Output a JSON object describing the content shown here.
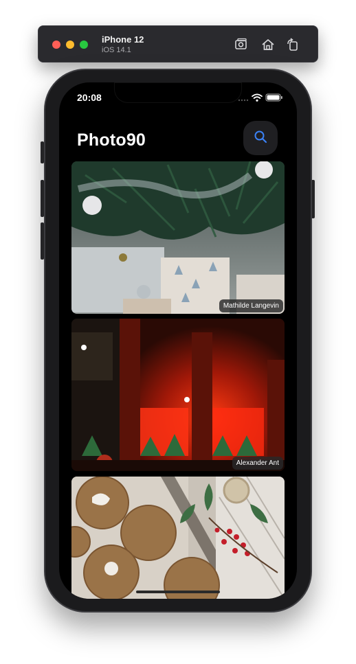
{
  "simulator": {
    "device_name": "iPhone 12",
    "os_version": "iOS 14.1"
  },
  "status_bar": {
    "time": "20:08"
  },
  "app": {
    "title": "Photo90"
  },
  "photos": [
    {
      "credit": "Mathilde Langevin"
    },
    {
      "credit": "Alexander Ant"
    },
    {
      "credit": ""
    }
  ],
  "colors": {
    "accent": "#3b82f6",
    "background": "#000000",
    "search_button_bg": "#1f1f22"
  },
  "icons": {
    "search": "magnifier",
    "wifi": "wifi",
    "battery": "battery-full"
  }
}
